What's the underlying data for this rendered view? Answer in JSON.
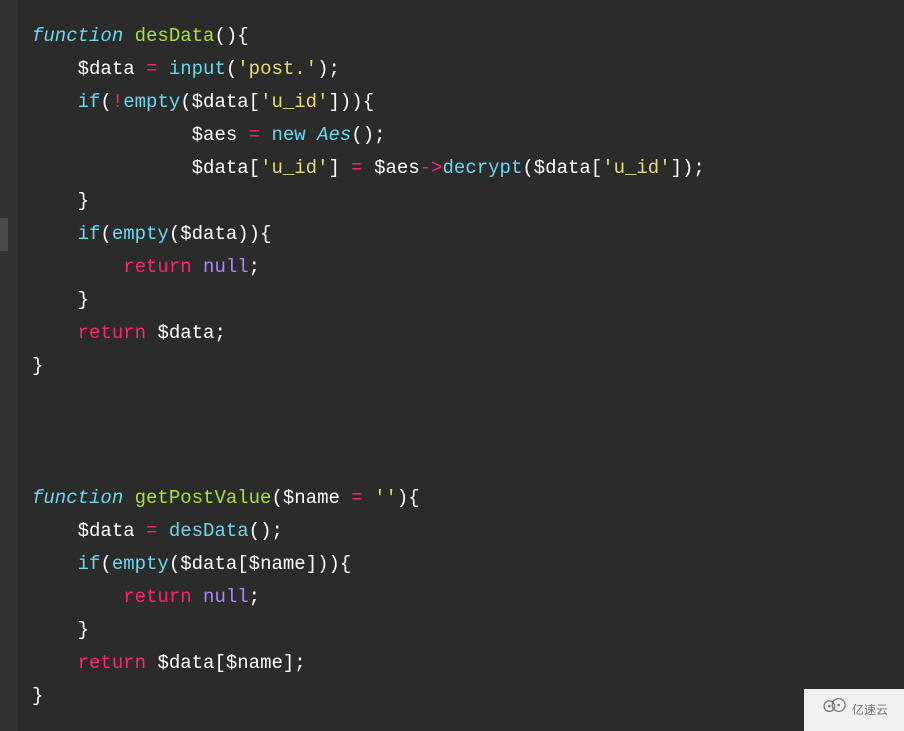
{
  "watermark": {
    "text": "亿速云"
  },
  "highlighted_line_index": 6,
  "code_lines": [
    {
      "indent": 0,
      "tokens": [
        {
          "t": "function ",
          "c": "keyword-i"
        },
        {
          "t": "desData",
          "c": "fname"
        },
        {
          "t": "(){",
          "c": "punc"
        }
      ]
    },
    {
      "indent": 1,
      "tokens": [
        {
          "t": "$data",
          "c": "var"
        },
        {
          "t": " = ",
          "c": "op"
        },
        {
          "t": "input",
          "c": "builtin"
        },
        {
          "t": "(",
          "c": "punc"
        },
        {
          "t": "'post.'",
          "c": "string"
        },
        {
          "t": ");",
          "c": "punc"
        }
      ]
    },
    {
      "indent": 1,
      "tokens": [
        {
          "t": "if",
          "c": "keyword"
        },
        {
          "t": "(",
          "c": "punc"
        },
        {
          "t": "!",
          "c": "op"
        },
        {
          "t": "empty",
          "c": "builtin"
        },
        {
          "t": "(",
          "c": "punc"
        },
        {
          "t": "$data",
          "c": "var"
        },
        {
          "t": "[",
          "c": "punc"
        },
        {
          "t": "'u_id'",
          "c": "string"
        },
        {
          "t": "])){",
          "c": "punc"
        }
      ]
    },
    {
      "indent": 2.5,
      "tokens": [
        {
          "t": "$aes",
          "c": "var"
        },
        {
          "t": " = ",
          "c": "op"
        },
        {
          "t": "new ",
          "c": "keyword"
        },
        {
          "t": "Aes",
          "c": "type-i"
        },
        {
          "t": "();",
          "c": "punc"
        }
      ]
    },
    {
      "indent": 2.5,
      "tokens": [
        {
          "t": "$data",
          "c": "var"
        },
        {
          "t": "[",
          "c": "punc"
        },
        {
          "t": "'u_id'",
          "c": "string"
        },
        {
          "t": "]",
          "c": "punc"
        },
        {
          "t": " = ",
          "c": "op"
        },
        {
          "t": "$aes",
          "c": "var"
        },
        {
          "t": "->",
          "c": "op"
        },
        {
          "t": "decrypt",
          "c": "builtin"
        },
        {
          "t": "(",
          "c": "punc"
        },
        {
          "t": "$data",
          "c": "var"
        },
        {
          "t": "[",
          "c": "punc"
        },
        {
          "t": "'u_id'",
          "c": "string"
        },
        {
          "t": "]);",
          "c": "punc"
        }
      ]
    },
    {
      "indent": 1,
      "tokens": [
        {
          "t": "}",
          "c": "punc"
        }
      ]
    },
    {
      "indent": 1,
      "tokens": [
        {
          "t": "if",
          "c": "keyword"
        },
        {
          "t": "(",
          "c": "punc"
        },
        {
          "t": "empty",
          "c": "builtin"
        },
        {
          "t": "(",
          "c": "punc"
        },
        {
          "t": "$data",
          "c": "var"
        },
        {
          "t": ")){",
          "c": "punc"
        }
      ]
    },
    {
      "indent": 2,
      "tokens": [
        {
          "t": "return ",
          "c": "return"
        },
        {
          "t": "null",
          "c": "null"
        },
        {
          "t": ";",
          "c": "punc"
        }
      ]
    },
    {
      "indent": 1,
      "tokens": [
        {
          "t": "}",
          "c": "punc"
        }
      ]
    },
    {
      "indent": 1,
      "tokens": [
        {
          "t": "return ",
          "c": "return"
        },
        {
          "t": "$data",
          "c": "var"
        },
        {
          "t": ";",
          "c": "punc"
        }
      ]
    },
    {
      "indent": 0,
      "tokens": [
        {
          "t": "}",
          "c": "punc"
        }
      ]
    },
    {
      "indent": 0,
      "tokens": []
    },
    {
      "indent": 0,
      "tokens": []
    },
    {
      "indent": 0,
      "tokens": []
    },
    {
      "indent": 0,
      "tokens": [
        {
          "t": "function ",
          "c": "keyword-i"
        },
        {
          "t": "getPostValue",
          "c": "fname"
        },
        {
          "t": "(",
          "c": "punc"
        },
        {
          "t": "$name",
          "c": "var"
        },
        {
          "t": " = ",
          "c": "op"
        },
        {
          "t": "''",
          "c": "string"
        },
        {
          "t": "){",
          "c": "punc"
        }
      ]
    },
    {
      "indent": 1,
      "tokens": [
        {
          "t": "$data",
          "c": "var"
        },
        {
          "t": " = ",
          "c": "op"
        },
        {
          "t": "desData",
          "c": "builtin"
        },
        {
          "t": "();",
          "c": "punc"
        }
      ]
    },
    {
      "indent": 1,
      "tokens": [
        {
          "t": "if",
          "c": "keyword"
        },
        {
          "t": "(",
          "c": "punc"
        },
        {
          "t": "empty",
          "c": "builtin"
        },
        {
          "t": "(",
          "c": "punc"
        },
        {
          "t": "$data",
          "c": "var"
        },
        {
          "t": "[",
          "c": "punc"
        },
        {
          "t": "$name",
          "c": "var"
        },
        {
          "t": "])){",
          "c": "punc"
        }
      ]
    },
    {
      "indent": 2,
      "tokens": [
        {
          "t": "return ",
          "c": "return"
        },
        {
          "t": "null",
          "c": "null"
        },
        {
          "t": ";",
          "c": "punc"
        }
      ]
    },
    {
      "indent": 1,
      "tokens": [
        {
          "t": "}",
          "c": "punc"
        }
      ]
    },
    {
      "indent": 1,
      "tokens": [
        {
          "t": "return ",
          "c": "return"
        },
        {
          "t": "$data",
          "c": "var"
        },
        {
          "t": "[",
          "c": "punc"
        },
        {
          "t": "$name",
          "c": "var"
        },
        {
          "t": "];",
          "c": "punc"
        }
      ]
    },
    {
      "indent": 0,
      "tokens": [
        {
          "t": "}",
          "c": "punc"
        }
      ]
    }
  ]
}
